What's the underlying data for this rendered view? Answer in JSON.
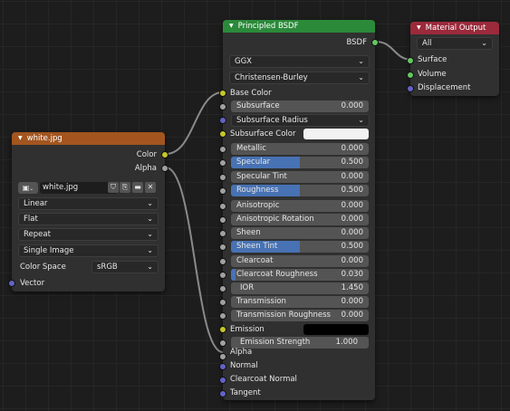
{
  "colors": {
    "image_header": "#a2551f",
    "shader_header": "#2b8a3a",
    "output_header": "#9b2a3b",
    "slider_fill": "#4772b3"
  },
  "image_node": {
    "title": "white.jpg",
    "outputs": [
      "Color",
      "Alpha"
    ],
    "image_name": "white.jpg",
    "interpolation": "Linear",
    "projection": "Flat",
    "extension": "Repeat",
    "source": "Single Image",
    "color_space_label": "Color Space",
    "color_space": "sRGB",
    "input_vector": "Vector"
  },
  "bsdf_node": {
    "title": "Principled BSDF",
    "output": "BSDF",
    "distribution": "GGX",
    "subsurface_method": "Christensen-Burley",
    "base_color": "Base Color",
    "subsurface": {
      "label": "Subsurface",
      "value": "0.000"
    },
    "subsurface_radius": "Subsurface Radius",
    "subsurface_color": "Subsurface Color",
    "metallic": {
      "label": "Metallic",
      "value": "0.000"
    },
    "specular": {
      "label": "Specular",
      "value": "0.500"
    },
    "specular_tint": {
      "label": "Specular Tint",
      "value": "0.000"
    },
    "roughness": {
      "label": "Roughness",
      "value": "0.500"
    },
    "anisotropic": {
      "label": "Anisotropic",
      "value": "0.000"
    },
    "anisotropic_rotation": {
      "label": "Anisotropic Rotation",
      "value": "0.000"
    },
    "sheen": {
      "label": "Sheen",
      "value": "0.000"
    },
    "sheen_tint": {
      "label": "Sheen Tint",
      "value": "0.500"
    },
    "clearcoat": {
      "label": "Clearcoat",
      "value": "0.000"
    },
    "clearcoat_roughness": {
      "label": "Clearcoat Roughness",
      "value": "0.030"
    },
    "ior": {
      "label": "IOR",
      "value": "1.450"
    },
    "transmission": {
      "label": "Transmission",
      "value": "0.000"
    },
    "transmission_roughness": {
      "label": "Transmission Roughness",
      "value": "0.000"
    },
    "emission": "Emission",
    "emission_strength": {
      "label": "Emission Strength",
      "value": "1.000"
    },
    "alpha": "Alpha",
    "normal": "Normal",
    "clearcoat_normal": "Clearcoat Normal",
    "tangent": "Tangent"
  },
  "output_node": {
    "title": "Material Output",
    "target": "All",
    "inputs": [
      "Surface",
      "Volume",
      "Displacement"
    ]
  }
}
